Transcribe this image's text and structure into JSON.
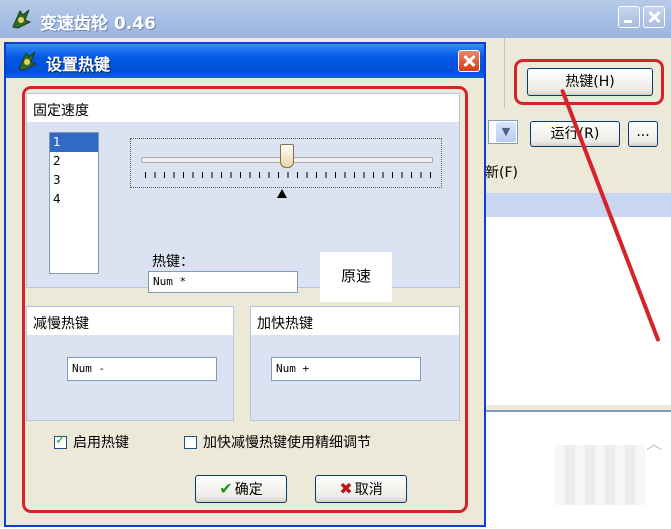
{
  "main": {
    "title": "变速齿轮 0.46",
    "hotkey_button": "热键(H)",
    "run_button": "运行(R)",
    "more_button": "...",
    "refresh_fragment": "新(F)"
  },
  "dialog": {
    "title": "设置热键",
    "fixed_speed": {
      "heading": "固定速度",
      "list_items": [
        "1",
        "2",
        "3",
        "4"
      ],
      "selected_index": 0,
      "hotkey_label": "热键：",
      "hotkey_value": "Num *",
      "original_speed_button": "原速"
    },
    "slow": {
      "heading": "减慢热键",
      "value": "Num -"
    },
    "fast": {
      "heading": "加快热键",
      "value": "Num +"
    },
    "enable_hotkey": {
      "label": "启用热键",
      "checked": true
    },
    "fine_tune": {
      "label": "加快减慢热键使用精细调节",
      "checked": false
    },
    "ok_button": "确定",
    "cancel_button": "取消"
  },
  "annotation_color": "#d4232b"
}
